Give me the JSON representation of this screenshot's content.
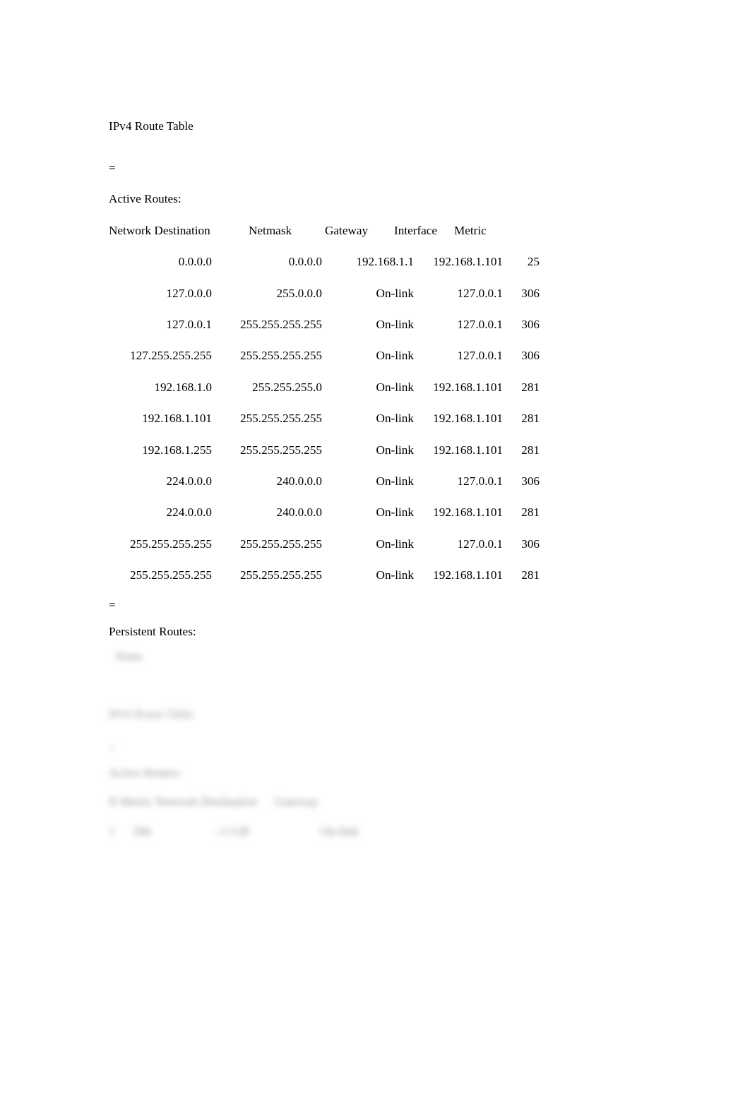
{
  "document": {
    "ipv4": {
      "title": "IPv4 Route Table",
      "separator_top": "===========================================================================",
      "active_routes_label": "Active Routes:",
      "columns": [
        "Network Destination",
        "Netmask",
        "Gateway",
        "Interface",
        "Metric"
      ],
      "header_line": "Network Destination        Netmask          Gateway       Interface  Metric",
      "rows": [
        {
          "destination": "0.0.0.0",
          "netmask": "0.0.0.0",
          "gateway": "192.168.1.1",
          "interface": "192.168.1.101",
          "metric": "25"
        },
        {
          "destination": "127.0.0.0",
          "netmask": "255.0.0.0",
          "gateway": "On-link",
          "interface": "127.0.0.1",
          "metric": "306"
        },
        {
          "destination": "127.0.0.1",
          "netmask": "255.255.255.255",
          "gateway": "On-link",
          "interface": "127.0.0.1",
          "metric": "306"
        },
        {
          "destination": "127.255.255.255",
          "netmask": "255.255.255.255",
          "gateway": "On-link",
          "interface": "127.0.0.1",
          "metric": "306"
        },
        {
          "destination": "192.168.1.0",
          "netmask": "255.255.255.0",
          "gateway": "On-link",
          "interface": "192.168.1.101",
          "metric": "281"
        },
        {
          "destination": "192.168.1.101",
          "netmask": "255.255.255.255",
          "gateway": "On-link",
          "interface": "192.168.1.101",
          "metric": "281"
        },
        {
          "destination": "192.168.1.255",
          "netmask": "255.255.255.255",
          "gateway": "On-link",
          "interface": "192.168.1.101",
          "metric": "281"
        },
        {
          "destination": "224.0.0.0",
          "netmask": "240.0.0.0",
          "gateway": "On-link",
          "interface": "127.0.0.1",
          "metric": "306"
        },
        {
          "destination": "224.0.0.0",
          "netmask": "240.0.0.0",
          "gateway": "On-link",
          "interface": "192.168.1.101",
          "metric": "281"
        },
        {
          "destination": "255.255.255.255",
          "netmask": "255.255.255.255",
          "gateway": "On-link",
          "interface": "127.0.0.1",
          "metric": "306"
        },
        {
          "destination": "255.255.255.255",
          "netmask": "255.255.255.255",
          "gateway": "On-link",
          "interface": "192.168.1.101",
          "metric": "281"
        }
      ],
      "separator_bottom": "===========================================================================",
      "persistent_routes_label": "Persistent Routes:",
      "persistent_routes_value": "None"
    },
    "ipv6": {
      "title": "IPv6 Route Table",
      "separator_top": "===========================================================================",
      "active_routes_label": "Active Routes:",
      "header_line": "If Metric Network Destination      Gateway",
      "rows": [
        {
          "if": "1",
          "metric": "306",
          "destination": "::1/128",
          "gateway": "On-link"
        }
      ]
    }
  }
}
